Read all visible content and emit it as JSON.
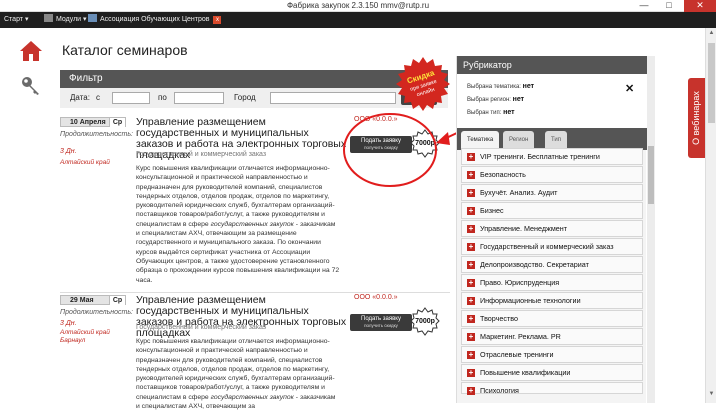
{
  "window": {
    "title": "Фабрика закупок 2.3.150 mmv@rutp.ru",
    "minimize": "—",
    "maximize": "□",
    "close": "✕"
  },
  "taskbar": {
    "start": "Старт",
    "modules": "Модули",
    "tab": "Ассоциация Обучающих Центров",
    "tab_close": "x"
  },
  "page": {
    "title": "Каталог семинаров"
  },
  "filter": {
    "header": "Фильтр",
    "date_label": "Дата:",
    "from_label": "с",
    "to_label": "по",
    "city_label": "Город",
    "button": "Найти"
  },
  "seal": {
    "line1": "Скидка",
    "line2": "при заявке",
    "line3": "онлайн"
  },
  "seminars": [
    {
      "date": "10 Апреля",
      "weekday": "Ср",
      "duration_label": "Продолжительность:",
      "duration": "3 Дн.",
      "city_line1": "Алтайский край",
      "city_line2": "",
      "title": "Управление размещением государственных и муниципальных заказов и работа на электронных торговых площадках",
      "category": "Государственный и коммерческий заказ",
      "desc_pre": "Курс повышения квалификации отличается информационно-консультационной и практической направленностью и предназначен для руководителей компаний, специалистов тендерных отделов, отделов продаж, отделов по маркетингу, руководителей юридических служб, бухгалтерам организаций-поставщиков товаров/работ/услуг, а также руководителям и специалистам в сфере ",
      "desc_em": "государственных закупок",
      "desc_post": " - заказчикам и специалистам АХЧ, отвечающим за размещение государственного и муниципального заказа. По окончании курсов выдаётся сертификат участника от Ассоциации Обучающих центров, а также удостоверение установленного образца о прохождении курсов повышения квалификации на 72 часа.",
      "org": "ООО «0.0.0.»",
      "apply_label": "Подать заявку",
      "apply_sub": "получить скидку",
      "price": "7000р"
    },
    {
      "date": "29 Мая",
      "weekday": "Ср",
      "duration_label": "Продолжительность:",
      "duration": "3 Дн.",
      "city_line1": "Алтайский край",
      "city_line2": "Барнаул",
      "title": "Управление размещением государственных и муниципальных заказов и работа на электронных торговых площадках",
      "category": "Государственный и коммерческий заказ",
      "desc_pre": "Курс повышения квалификации отличается информационно-консультационной и практической направленностью и предназначен для руководителей компаний, специалистов тендерных отделов, отделов продаж, отделов по маркетингу, руководителей юридических служб, бухгалтерам организаций-поставщиков товаров/работ/услуг, а также руководителям и специалистам в сфере ",
      "desc_em": "государственных закупок",
      "desc_post": " - заказчикам и специалистам АХЧ, отвечающим за",
      "org": "ООО «0.0.0.»",
      "apply_label": "Подать заявку",
      "apply_sub": "получить скидку",
      "price": "7000р"
    }
  ],
  "rubricator": {
    "header": "Рубрикатор",
    "theme_label": "Выбрана тематика:",
    "theme_value": "нет",
    "region_label": "Выбран регион:",
    "region_value": "нет",
    "type_label": "Выбран тип:",
    "type_value": "нет",
    "close": "✕",
    "tabs": [
      "Тематика",
      "Регион",
      "Тип"
    ],
    "items": [
      "VIP тренинги. Бесплатные тренинги",
      "Безопасность",
      "Бухучёт. Анализ. Аудит",
      "Бизнес",
      "Управление. Менеджмент",
      "Государственный и коммерческий заказ",
      "Делопроизводство. Секретариат",
      "Право. Юриспруденция",
      "Информационные технологии",
      "Творчество",
      "Маркетинг. Реклама. PR",
      "Отраслевые тренинги",
      "Повышение квалификации",
      "Психология"
    ]
  },
  "webinar_tab": "О вебинарах",
  "colors": {
    "accent_red": "#c0271f",
    "header_gray": "#555555",
    "taskbar": "#1f1f1f"
  }
}
